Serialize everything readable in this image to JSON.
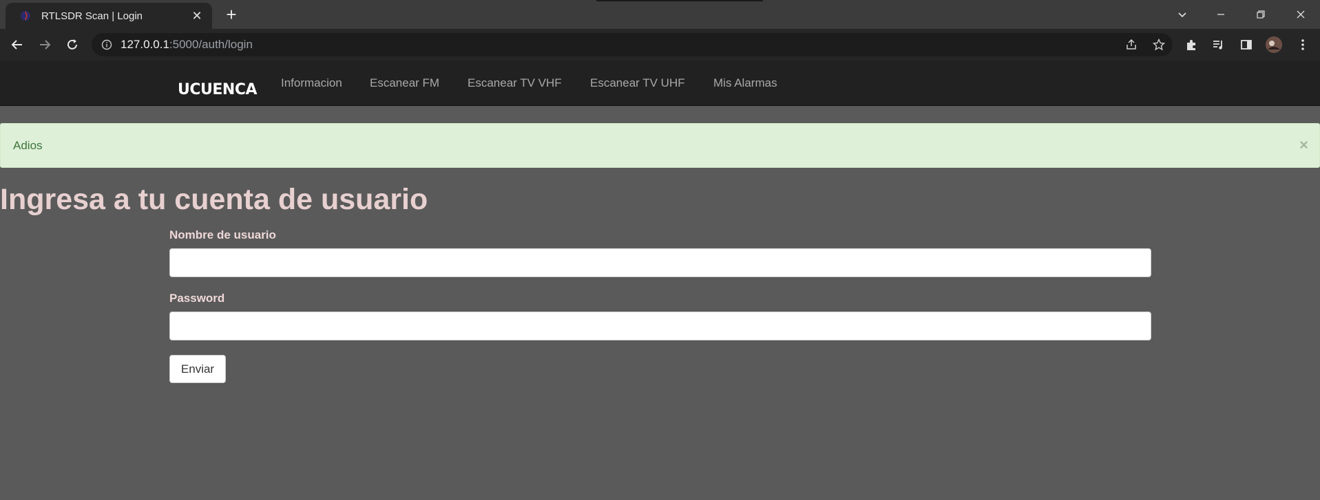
{
  "browser": {
    "tab_title": "RTLSDR Scan | Login",
    "close_tab": "✕",
    "new_tab": "+",
    "url_host": "127.0.0.1",
    "url_path": ":5000/auth/login"
  },
  "navbar": {
    "brand": "UCUENCA",
    "links": [
      "Informacion",
      "Escanear FM",
      "Escanear TV VHF",
      "Escanear TV UHF",
      "Mis Alarmas"
    ]
  },
  "alert": {
    "message": "Adios",
    "close": "×"
  },
  "login": {
    "heading": "Ingresa a tu cuenta de usuario",
    "username_label": "Nombre de usuario",
    "username_value": "",
    "password_label": "Password",
    "password_value": "",
    "submit_label": "Enviar"
  },
  "colors": {
    "page_bg": "#5a5a5a",
    "navbar_bg": "#212121",
    "alert_bg": "#dff0d8",
    "alert_text": "#3c763d",
    "heading_text": "#e8d0d0"
  }
}
